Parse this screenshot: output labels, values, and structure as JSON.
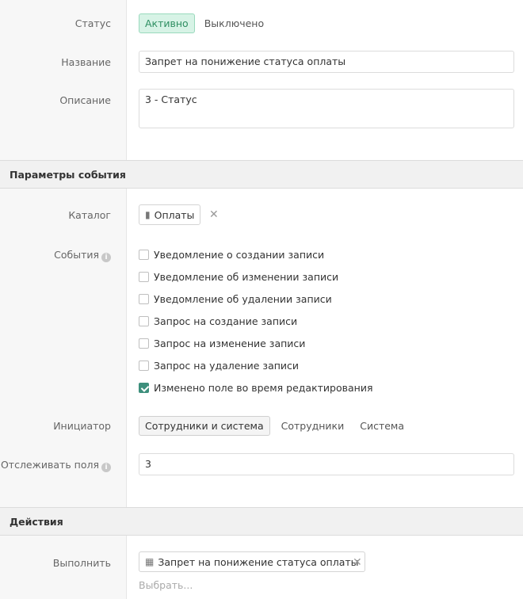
{
  "general": {
    "status_label": "Статус",
    "status_options": [
      "Активно",
      "Выключено"
    ],
    "name_label": "Название",
    "name_value": "Запрет на понижение статуса оплаты",
    "description_label": "Описание",
    "description_value": "3 - Статус"
  },
  "event_params": {
    "header": "Параметры события",
    "catalog_label": "Каталог",
    "catalog_value": "Оплаты",
    "catalog_icon": "book-icon",
    "events_label": "События",
    "events": [
      {
        "label": "Уведомление о создании записи",
        "checked": false
      },
      {
        "label": "Уведомление об изменении записи",
        "checked": false
      },
      {
        "label": "Уведомление об удалении записи",
        "checked": false
      },
      {
        "label": "Запрос на создание записи",
        "checked": false
      },
      {
        "label": "Запрос на изменение записи",
        "checked": false
      },
      {
        "label": "Запрос на удаление записи",
        "checked": false
      },
      {
        "label": "Изменено поле во время редактирования",
        "checked": true
      }
    ],
    "initiator_label": "Инициатор",
    "initiator_options": [
      "Сотрудники и система",
      "Сотрудники",
      "Система"
    ],
    "initiator_selected": "Сотрудники и система",
    "track_fields_label": "Отслеживать поля",
    "track_fields_value": "3"
  },
  "actions": {
    "header": "Действия",
    "execute_label": "Выполнить",
    "execute_value": "Запрет на понижение статуса оплаты",
    "execute_icon": "hierarchy-icon",
    "select_placeholder": "Выбрать..."
  },
  "colors": {
    "active_green": "#2f8f62",
    "checkbox_checked": "#3d8f7c"
  }
}
